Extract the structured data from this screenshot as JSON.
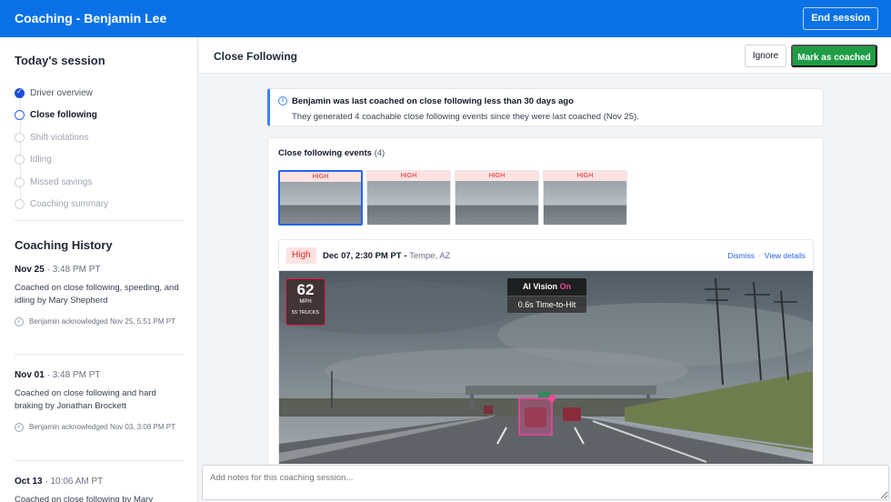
{
  "header": {
    "title": "Coaching - Benjamin Lee",
    "end_label": "End session"
  },
  "sidebar": {
    "session_title": "Today's session",
    "steps": [
      {
        "label": "Driver overview",
        "state": "done"
      },
      {
        "label": "Close following",
        "state": "current"
      },
      {
        "label": "Shift violations",
        "state": "pending"
      },
      {
        "label": "Idling",
        "state": "pending"
      },
      {
        "label": "Missed savings",
        "state": "pending"
      },
      {
        "label": "Coaching summary",
        "state": "pending"
      }
    ],
    "history_title": "Coaching History",
    "history": [
      {
        "date": "Nov 25",
        "time": "3:48 PM PT",
        "desc": "Coached on close following, speeding, and idling by Mary Shepherd",
        "ack": "Benjamin acknowledged Nov 25, 5:51 PM PT"
      },
      {
        "date": "Nov 01",
        "time": "3:48 PM PT",
        "desc": "Coached on close following and hard braking by Jonathan Brockett",
        "ack": "Benjamin acknowledged Nov 03, 3:08 PM PT"
      },
      {
        "date": "Oct 13",
        "time": "10:06 AM PT",
        "desc": "Coached on close following by Mary"
      }
    ]
  },
  "main": {
    "title": "Close Following",
    "ignore_label": "Ignore",
    "coached_label": "Mark as coached",
    "banner": {
      "title": "Benjamin was last coached on close following less than 30 days ago",
      "body": "They generated 4 coachable close following events since they were last coached (Nov 25)."
    },
    "events": {
      "title": "Close following events",
      "count": "(4)",
      "thumbs": [
        {
          "label": "HIGH"
        },
        {
          "label": "HIGH"
        },
        {
          "label": "HIGH"
        },
        {
          "label": "HIGH"
        }
      ]
    },
    "detail": {
      "severity": "High",
      "datetime": "Dec 07, 2:30 PM PT",
      "location": "Tempe, AZ",
      "dismiss": "Dismiss",
      "view": "View details",
      "speed": "62",
      "speed_unit": "MPH",
      "speed_label": "55 TRUCKS",
      "ai_label": "AI Vision",
      "ai_state": "On",
      "ttc": "0.6s Time-to-Hit"
    },
    "notes_placeholder": "Add notes for this coaching session..."
  },
  "colors": {
    "brand": "#0a72e6",
    "success": "#1f9d45",
    "danger": "#dc2626",
    "highlight": "#ec4899"
  }
}
